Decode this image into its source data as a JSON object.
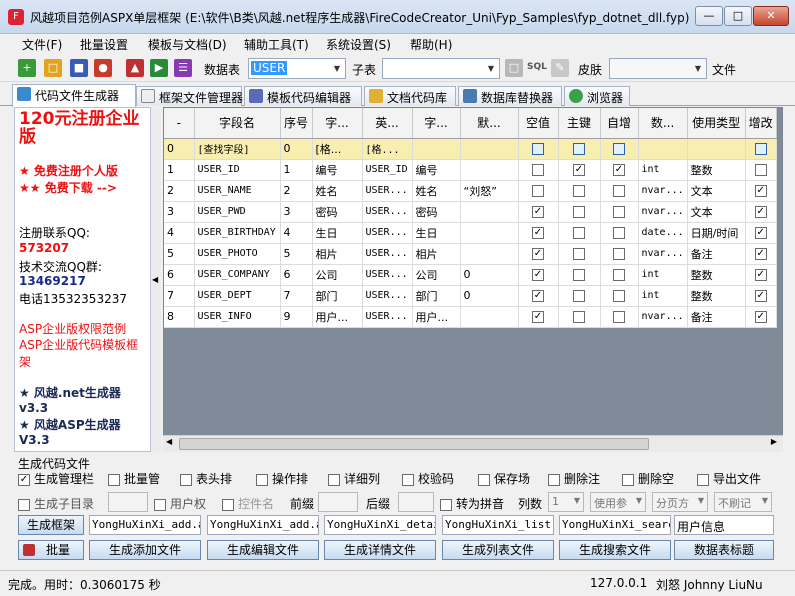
{
  "window": {
    "title": "风越项目范例ASPX单层框架 (E:\\软件\\B类\\风越.net程序生成器\\FireCodeCreator_Uni\\Fyp_Samples\\fyp_dotnet_dll.fyp)"
  },
  "menu": [
    "文件(F)",
    "批量设置",
    "模板与文档(D)",
    "辅助工具(T)",
    "系统设置(S)",
    "帮助(H)"
  ],
  "toolbar": {
    "table_label": "数据表",
    "table_value": "USER",
    "subtable_label": "子表",
    "sql_label": "SQL",
    "skin_label": "皮肤",
    "file_label": "文件"
  },
  "tabs": [
    "代码文件生成器",
    "框架文件管理器",
    "模板代码编辑器",
    "文档代码库",
    "数据库替换器",
    "浏览器"
  ],
  "left": {
    "price_title": "120元注册企业版",
    "line1": "★ 免费注册个人版",
    "line2": "★★ 免费下载 -->",
    "qq_label": "注册联系QQ:",
    "qq_value": "573207",
    "group_label": "技术交流QQ群:",
    "group_value": "13469217",
    "phone": "电话13532353237",
    "asp1": "ASP企业版权限范例",
    "asp2": "ASP企业版代码模板框架",
    "net_gen": "★ 风越.net生成器v3.3",
    "asp_gen": "★ 风越ASP生成器V3.3"
  },
  "grid": {
    "headers": [
      "-",
      "字段名",
      "序号",
      "字...",
      "英...",
      "字...",
      "默...",
      "空值",
      "主键",
      "自增",
      "数...",
      "使用类型",
      "增改"
    ],
    "rows": [
      {
        "idx": "0",
        "name": "[查找字段]",
        "seq": "0",
        "c1": "[格...",
        "c2": "[格...",
        "c3": "",
        "def": "",
        "null": "blue",
        "pk": "blue",
        "ai": "blue",
        "dtype": "",
        "utype": "",
        "edit": "blue"
      },
      {
        "idx": "1",
        "name": "USER_ID",
        "seq": "1",
        "c1": "编号",
        "c2": "USER_ID",
        "c3": "编号",
        "def": "",
        "null": "",
        "pk": "x",
        "ai": "x",
        "dtype": "int",
        "utype": "整数",
        "edit": ""
      },
      {
        "idx": "2",
        "name": "USER_NAME",
        "seq": "2",
        "c1": "姓名",
        "c2": "USER...",
        "c3": "姓名",
        "def": "“刘怒”",
        "null": "",
        "pk": "",
        "ai": "",
        "dtype": "nvar...",
        "utype": "文本",
        "edit": "x"
      },
      {
        "idx": "3",
        "name": "USER_PWD",
        "seq": "3",
        "c1": "密码",
        "c2": "USER...",
        "c3": "密码",
        "def": "",
        "null": "x",
        "pk": "",
        "ai": "",
        "dtype": "nvar...",
        "utype": "文本",
        "edit": "x"
      },
      {
        "idx": "4",
        "name": "USER_BIRTHDAY",
        "seq": "4",
        "c1": "生日",
        "c2": "USER...",
        "c3": "生日",
        "def": "",
        "null": "x",
        "pk": "",
        "ai": "",
        "dtype": "date...",
        "utype": "日期/时间",
        "edit": "x"
      },
      {
        "idx": "5",
        "name": "USER_PHOTO",
        "seq": "5",
        "c1": "相片",
        "c2": "USER...",
        "c3": "相片",
        "def": "",
        "null": "x",
        "pk": "",
        "ai": "",
        "dtype": "nvar...",
        "utype": "备注",
        "edit": "x"
      },
      {
        "idx": "6",
        "name": "USER_COMPANY",
        "seq": "6",
        "c1": "公司",
        "c2": "USER...",
        "c3": "公司",
        "def": "0",
        "null": "x",
        "pk": "",
        "ai": "",
        "dtype": "int",
        "utype": "整数",
        "edit": "x"
      },
      {
        "idx": "7",
        "name": "USER_DEPT",
        "seq": "7",
        "c1": "部门",
        "c2": "USER...",
        "c3": "部门",
        "def": "0",
        "null": "x",
        "pk": "",
        "ai": "",
        "dtype": "int",
        "utype": "整数",
        "edit": "x"
      },
      {
        "idx": "8",
        "name": "USER_INFO",
        "seq": "9",
        "c1": "用户...",
        "c2": "USER...",
        "c3": "用户...",
        "def": "",
        "null": "x",
        "pk": "",
        "ai": "",
        "dtype": "nvar...",
        "utype": "备注",
        "edit": "x"
      }
    ]
  },
  "gen": {
    "section_label": "生成代码文件",
    "opts_row1": [
      "生成管理栏",
      "批量管",
      "表头排",
      "操作排",
      "详细列",
      "校验码",
      "保存场",
      "删除注",
      "删除空",
      "导出文件"
    ],
    "opts_row1_checked": [
      true,
      false,
      false,
      false,
      false,
      false,
      false,
      false,
      false,
      false
    ],
    "subdir_label": "生成子目录",
    "user_perm_label": "用户权",
    "control_label": "控件名",
    "prefix_label": "前缀",
    "suffix_label": "后缀",
    "pinyin_label": "转为拼音",
    "columns_label": "列数",
    "columns_value": "1",
    "use_param": "使用参",
    "paging": "分页方",
    "no_refresh": "不刷记",
    "files": [
      "YongHuXinXi_add.aspx",
      "YongHuXinXi_add.aspx.cs",
      "YongHuXinXi_detail",
      "YongHuXinXi_list.aspx",
      "YongHuXinXi_search"
    ],
    "user_info": "用户信息",
    "frame_btn": "生成框架",
    "batch_btn": "批量",
    "btn_add": "生成添加文件",
    "btn_edit": "生成编辑文件",
    "btn_detail": "生成详情文件",
    "btn_list": "生成列表文件",
    "btn_search": "生成搜索文件",
    "btn_table_title": "数据表标题"
  },
  "status": {
    "text": "完成。用时：0.3060175 秒",
    "ip": "127.0.0.1",
    "user": "刘怒 Johnny LiuNu"
  }
}
